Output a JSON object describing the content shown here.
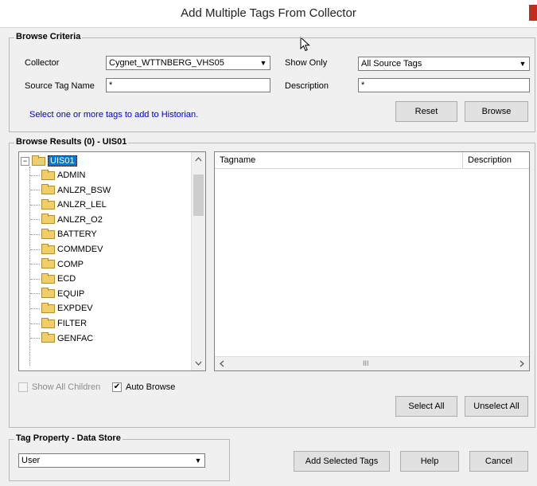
{
  "window": {
    "title": "Add Multiple Tags From Collector"
  },
  "browse_criteria": {
    "title": "Browse Criteria",
    "collector_label": "Collector",
    "collector_value": "Cygnet_WTTNBERG_VHS05",
    "show_only_label": "Show Only",
    "show_only_value": "All Source Tags",
    "source_tag_label": "Source Tag Name",
    "source_tag_value": "*",
    "description_label": "Description",
    "description_value": "*",
    "hint": "Select one or more tags to add to Historian.",
    "reset_label": "Reset",
    "browse_label": "Browse"
  },
  "browse_results": {
    "title": "Browse Results (0) - UIS01",
    "root": "UIS01",
    "items": [
      "ADMIN",
      "ANLZR_BSW",
      "ANLZR_LEL",
      "ANLZR_O2",
      "BATTERY",
      "COMMDEV",
      "COMP",
      "ECD",
      "EQUIP",
      "EXPDEV",
      "FILTER",
      "GENFAC"
    ],
    "columns": [
      "Tagname",
      "Description"
    ],
    "show_all_children_label": "Show All Children",
    "auto_browse_label": "Auto Browse",
    "auto_browse_checked": true,
    "select_all_label": "Select All",
    "unselect_all_label": "Unselect All"
  },
  "tag_property": {
    "title": "Tag Property - Data Store",
    "value": "User"
  },
  "footer": {
    "add_label": "Add Selected Tags",
    "help_label": "Help",
    "cancel_label": "Cancel"
  },
  "icons": [
    "close-icon",
    "cursor-icon",
    "folder-icon",
    "collapse-icon",
    "dropdown-arrow-icon",
    "scroll-up-icon",
    "scroll-down-icon",
    "scroll-left-icon",
    "scroll-right-icon",
    "checkmark-icon"
  ],
  "colors": {
    "link": "#0000cc",
    "selection": "#0078d7",
    "close": "#c42b1c"
  }
}
